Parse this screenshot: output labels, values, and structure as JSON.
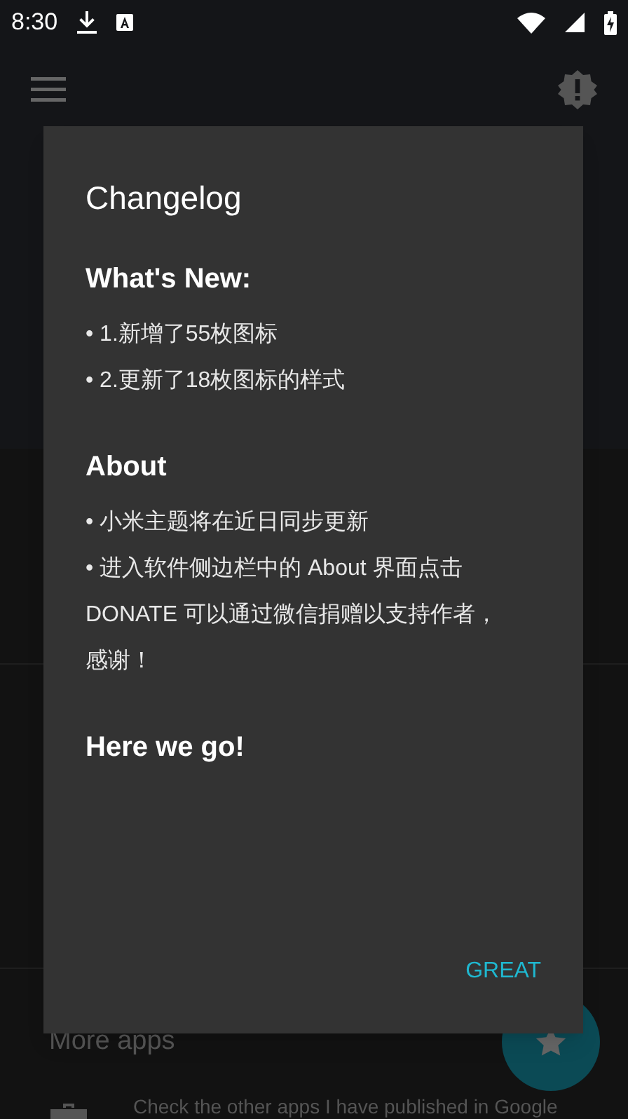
{
  "status_bar": {
    "time": "8:30"
  },
  "dialog": {
    "title": "Changelog",
    "sections": [
      {
        "heading": "What's New:",
        "lines": [
          "• 1.新增了55枚图标",
          "• 2.更新了18枚图标的样式"
        ]
      },
      {
        "heading": "About",
        "lines": [
          "• 小米主题将在近日同步更新",
          "• 进入软件侧边栏中的 About 界面点击 DONATE 可以通过微信捐赠以支持作者，感谢！"
        ]
      },
      {
        "heading": "Here we go!"
      }
    ],
    "button": "GREAT"
  },
  "background": {
    "section_title": "More apps",
    "item_text": "Check the other apps I have published in Google"
  }
}
